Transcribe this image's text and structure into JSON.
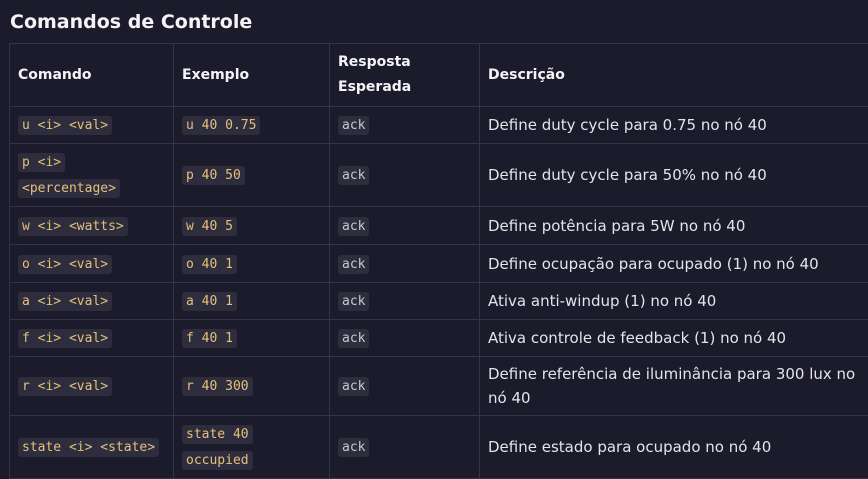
{
  "title": "Comandos de Controle",
  "columns": [
    "Comando",
    "Exemplo",
    "Resposta Esperada",
    "Descrição"
  ],
  "rows": [
    {
      "command": "u <i> <val>",
      "example": "u 40 0.75",
      "response": "ack",
      "description": "Define duty cycle para 0.75 no nó 40"
    },
    {
      "command": "p <i> <percentage>",
      "example": "p 40 50",
      "response": "ack",
      "description": "Define duty cycle para 50% no nó 40"
    },
    {
      "command": "w <i> <watts>",
      "example": "w 40 5",
      "response": "ack",
      "description": "Define potência para 5W no nó 40"
    },
    {
      "command": "o <i> <val>",
      "example": "o 40 1",
      "response": "ack",
      "description": "Define ocupação para ocupado (1) no nó 40"
    },
    {
      "command": "a <i> <val>",
      "example": "a 40 1",
      "response": "ack",
      "description": "Ativa anti-windup (1) no nó 40"
    },
    {
      "command": "f <i> <val>",
      "example": "f 40 1",
      "response": "ack",
      "description": "Ativa controle de feedback (1) no nó 40"
    },
    {
      "command": "r <i> <val>",
      "example": "r 40 300",
      "response": "ack",
      "description": "Define referência de iluminância para 300 lux no nó 40"
    },
    {
      "command": "state <i> <state>",
      "example": "state 40 occupied",
      "response": "ack",
      "description": "Define estado para ocupado no nó 40"
    }
  ],
  "colors": {
    "background": "#1b1b2b",
    "border": "#343448",
    "code_text": "#e5c07b",
    "code_background": "#2d2d3e"
  }
}
